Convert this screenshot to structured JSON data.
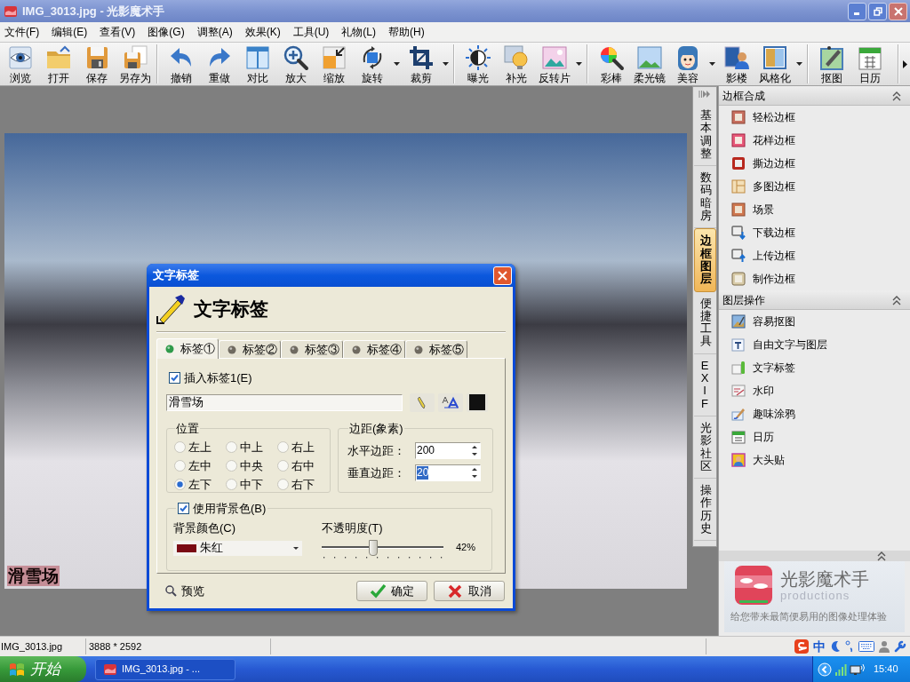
{
  "window": {
    "title": "IMG_3013.jpg - 光影魔术手"
  },
  "menu": [
    "文件(F)",
    "编辑(E)",
    "查看(V)",
    "图像(G)",
    "调整(A)",
    "效果(K)",
    "工具(U)",
    "礼物(L)",
    "帮助(H)"
  ],
  "toolbar": {
    "groups": [
      {
        "items": [
          {
            "label": "浏览",
            "dropdown": false
          },
          {
            "label": "打开",
            "dropdown": false
          },
          {
            "label": "保存",
            "dropdown": false
          },
          {
            "label": "另存为",
            "dropdown": false
          }
        ]
      },
      {
        "items": [
          {
            "label": "撤销",
            "dropdown": false
          },
          {
            "label": "重做",
            "dropdown": false
          },
          {
            "label": "对比",
            "dropdown": false
          },
          {
            "label": "放大",
            "dropdown": false
          },
          {
            "label": "缩放",
            "dropdown": false
          },
          {
            "label": "旋转",
            "dropdown": true
          },
          {
            "label": "裁剪",
            "dropdown": true
          }
        ]
      },
      {
        "items": [
          {
            "label": "曝光",
            "dropdown": false
          },
          {
            "label": "补光",
            "dropdown": false
          },
          {
            "label": "反转片",
            "dropdown": true
          }
        ]
      },
      {
        "items": [
          {
            "label": "彩棒",
            "dropdown": false
          },
          {
            "label": "柔光镜",
            "dropdown": false
          },
          {
            "label": "美容",
            "dropdown": true
          },
          {
            "label": "影楼",
            "dropdown": false
          },
          {
            "label": "风格化",
            "dropdown": true
          }
        ]
      },
      {
        "items": [
          {
            "label": "抠图",
            "dropdown": false
          },
          {
            "label": "日历",
            "dropdown": false
          }
        ]
      }
    ]
  },
  "canvas": {
    "overlay_text": "滑雪场"
  },
  "side_tabs": [
    {
      "label": "基本调整",
      "selected": false
    },
    {
      "label": "数码暗房",
      "selected": false
    },
    {
      "label": "边框图层",
      "selected": true
    },
    {
      "label": "便捷工具",
      "selected": false
    },
    {
      "label": "EXIF",
      "selected": false
    },
    {
      "label": "光影社区",
      "selected": false
    },
    {
      "label": "操作历史",
      "selected": false
    }
  ],
  "panel": {
    "sections": [
      {
        "title": "边框合成",
        "expanded": true,
        "items": [
          "轻松边框",
          "花样边框",
          "撕边边框",
          "多图边框",
          "场景",
          "下载边框",
          "上传边框",
          "制作边框"
        ]
      },
      {
        "title": "图层操作",
        "expanded": true,
        "items": [
          "容易抠图",
          "自由文字与图层",
          "文字标签",
          "水印",
          "趣味涂鸦",
          "日历",
          "大头贴"
        ]
      }
    ],
    "promo": {
      "expanded": true,
      "title": "光影魔术手",
      "subtitle": "productions",
      "tagline": "给您带来最简便易用的图像处理体验"
    }
  },
  "dialog": {
    "title": "文字标签",
    "heading": "文字标签",
    "tabs": [
      {
        "label": "标签①",
        "selected": true
      },
      {
        "label": "标签②",
        "selected": false
      },
      {
        "label": "标签③",
        "selected": false
      },
      {
        "label": "标签④",
        "selected": false
      },
      {
        "label": "标签⑤",
        "selected": false
      }
    ],
    "insert": {
      "label": "插入标签1(E)",
      "checked": true
    },
    "text": "滑雪场",
    "position": {
      "title": "位置",
      "options": [
        {
          "label": "左上",
          "selected": false
        },
        {
          "label": "中上",
          "selected": false
        },
        {
          "label": "右上",
          "selected": false
        },
        {
          "label": "左中",
          "selected": false
        },
        {
          "label": "中央",
          "selected": false
        },
        {
          "label": "右中",
          "selected": false
        },
        {
          "label": "左下",
          "selected": true
        },
        {
          "label": "中下",
          "selected": false
        },
        {
          "label": "右下",
          "selected": false
        }
      ]
    },
    "margins": {
      "title": "边距(象素)",
      "fields": [
        {
          "label": "水平边距：",
          "value": "200",
          "focused": false
        },
        {
          "label": "垂直边距：",
          "value": "20",
          "focused": true
        }
      ]
    },
    "background": {
      "enabled": {
        "label": "使用背景色(B)",
        "checked": true
      },
      "color_label": "背景颜色(C)",
      "color_name": "朱红",
      "opacity_label": "不透明度(T)",
      "opacity": {
        "level": 0.42,
        "reading": "42%"
      }
    },
    "preview": "预览",
    "buttons": [
      {
        "label": "确定",
        "kind": "ok"
      },
      {
        "label": "取消",
        "kind": "cancel"
      }
    ]
  },
  "status_bar": {
    "file": "IMG_3013.jpg",
    "dimensions": "3888 * 2592",
    "ime_mode": "中"
  },
  "taskbar": {
    "start": "开始",
    "tasks": [
      "IMG_3013.jpg - ..."
    ],
    "clock": "15:40"
  }
}
